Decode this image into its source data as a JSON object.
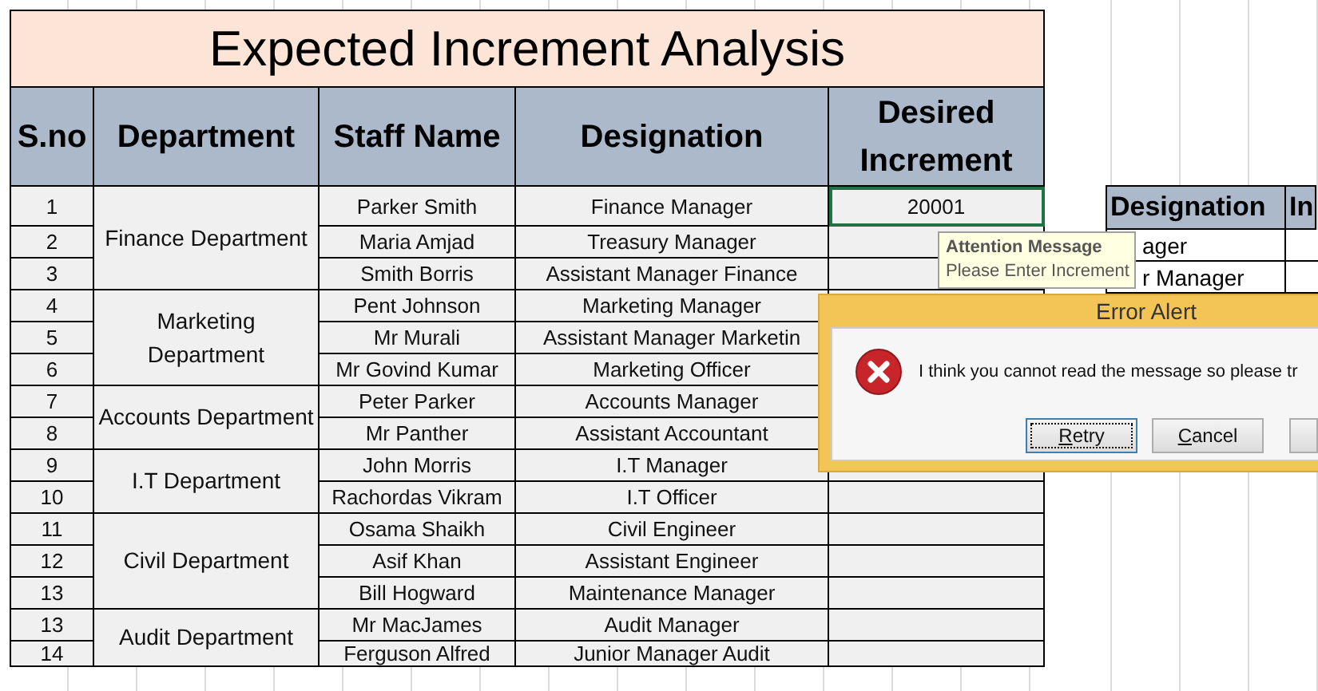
{
  "sheet": {
    "title": "Expected Increment Analysis",
    "columns": [
      "S.no",
      "Department",
      "Staff Name",
      "Designation",
      "Desired Increment"
    ],
    "departments": [
      {
        "name": "Finance Department",
        "staff": [
          {
            "sno": "1",
            "name": "Parker Smith",
            "designation": "Finance Manager",
            "increment": "20001",
            "selected": true
          },
          {
            "sno": "2",
            "name": "Maria Amjad",
            "designation": "Treasury Manager",
            "selected": false
          },
          {
            "sno": "3",
            "name": "Smith Borris",
            "designation": "Assistant Manager Finance",
            "selected": false
          }
        ]
      },
      {
        "name": "Marketing Department",
        "staff": [
          {
            "sno": "4",
            "name": "Pent Johnson",
            "designation": "Marketing Manager",
            "selected": false
          },
          {
            "sno": "5",
            "name": "Mr Murali",
            "designation": "Assistant Manager Marketin"
          },
          {
            "sno": "6",
            "name": "Mr Govind Kumar",
            "designation": "Marketing Officer"
          }
        ]
      },
      {
        "name": "Accounts Department",
        "staff": [
          {
            "sno": "7",
            "name": "Peter Parker",
            "designation": "Accounts Manager"
          },
          {
            "sno": "8",
            "name": "Mr Panther",
            "designation": "Assistant Accountant"
          }
        ]
      },
      {
        "name": "I.T Department",
        "staff": [
          {
            "sno": "9",
            "name": "John Morris",
            "designation": "I.T Manager",
            "selected": false
          },
          {
            "sno": "10",
            "name": "Rachordas Vikram",
            "designation": "I.T Officer",
            "selected": false
          }
        ]
      },
      {
        "name": "Civil Department",
        "staff": [
          {
            "sno": "11",
            "name": "Osama Shaikh",
            "designation": "Civil Engineer",
            "selected": false
          },
          {
            "sno": "12",
            "name": "Asif Khan",
            "designation": "Assistant Engineer",
            "selected": false
          },
          {
            "sno": "13",
            "name": "Bill Hogward",
            "designation": "Maintenance Manager",
            "selected": false
          }
        ]
      },
      {
        "name": "Audit Department",
        "staff": [
          {
            "sno": "13",
            "name": "Mr MacJames",
            "designation": "Audit Manager",
            "selected": false
          },
          {
            "sno": "14",
            "name": "Ferguson Alfred",
            "designation": "Junior Manager Audit",
            "selected": false
          }
        ]
      }
    ]
  },
  "side_table": {
    "columns": [
      "Designation",
      "In"
    ],
    "rows": [
      "ager",
      "r Manager"
    ]
  },
  "tooltip": {
    "title": "Attention Message",
    "text": "Please Enter Increment"
  },
  "dialog": {
    "title": "Error Alert",
    "message": "I think you cannot read the message so please tr",
    "buttons": [
      {
        "label": "Retry",
        "focused": true
      },
      {
        "label": "Cancel",
        "focused": false
      },
      {
        "focused": false
      }
    ]
  }
}
